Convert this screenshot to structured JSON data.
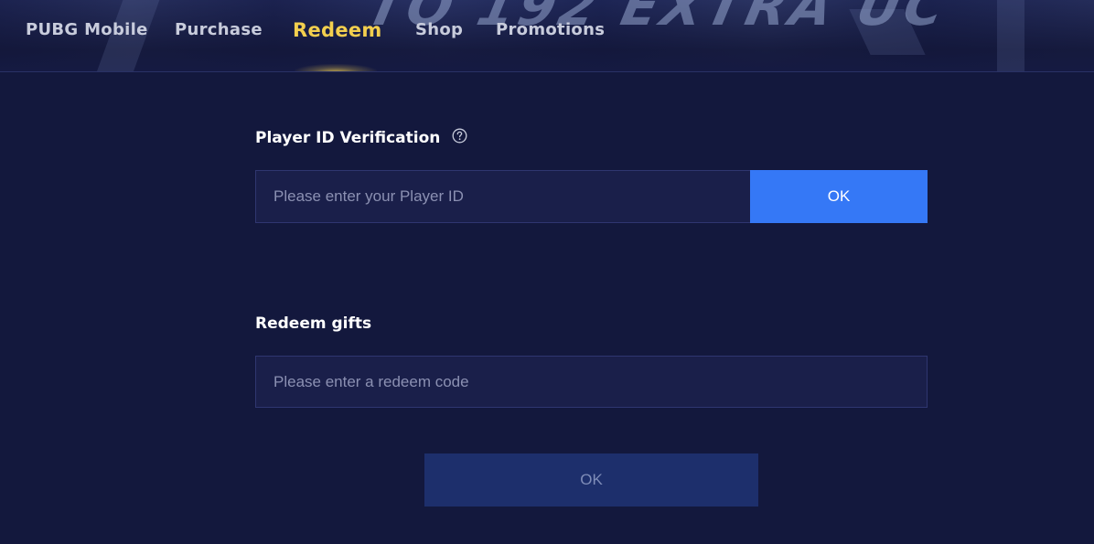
{
  "header": {
    "banner_text": "TO 192 EXTRA UC",
    "nav": [
      {
        "label": "PUBG Mobile",
        "active": false
      },
      {
        "label": "Purchase",
        "active": false
      },
      {
        "label": "Redeem",
        "active": true
      },
      {
        "label": "Shop",
        "active": false
      },
      {
        "label": "Promotions",
        "active": false
      }
    ]
  },
  "verification": {
    "title": "Player ID Verification",
    "help_icon": "question-circle-icon",
    "input_placeholder": "Please enter your Player ID",
    "button_label": "OK"
  },
  "redeem": {
    "title": "Redeem gifts",
    "input_placeholder": "Please enter a redeem code",
    "button_label": "OK",
    "button_enabled": false
  },
  "colors": {
    "background": "#13183d",
    "active_nav": "#f3cf4e",
    "primary_button": "#3578f6",
    "disabled_button": "#1d2f6c",
    "input_background": "#1a1f4a"
  }
}
